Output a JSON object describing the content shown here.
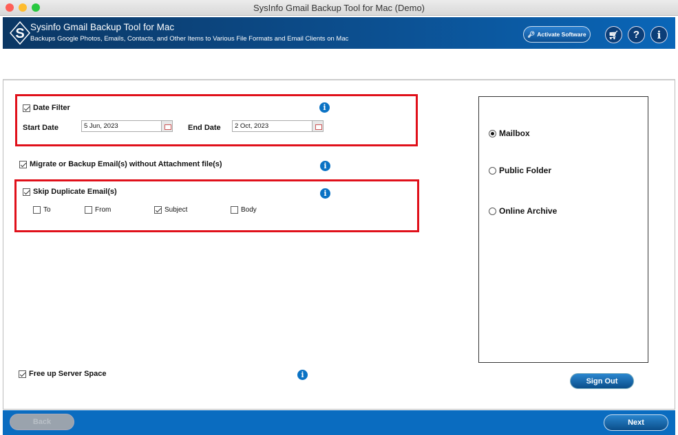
{
  "window": {
    "title": "SysInfo Gmail Backup Tool for Mac (Demo)"
  },
  "header": {
    "title": "Sysinfo Gmail Backup Tool for Mac",
    "subtitle": "Backups Google Photos, Emails, Contacts, and Other Items to Various File Formats and Email Clients on Mac",
    "activate_label": "Activate Software",
    "cart": "cart-icon",
    "help": "?",
    "info": "i"
  },
  "date_filter": {
    "label": "Date Filter",
    "checked": true,
    "start_label": "Start Date",
    "start_value": "5 Jun, 2023",
    "end_label": "End Date",
    "end_value": "2 Oct, 2023"
  },
  "no_attachment": {
    "label": "Migrate or Backup Email(s) without Attachment file(s)",
    "checked": true
  },
  "skip_duplicate": {
    "label": "Skip Duplicate Email(s)",
    "checked": true,
    "options": [
      {
        "label": "To",
        "checked": false
      },
      {
        "label": "From",
        "checked": false
      },
      {
        "label": "Subject",
        "checked": true
      },
      {
        "label": "Body",
        "checked": false
      }
    ]
  },
  "free_space": {
    "label": "Free up Server Space",
    "checked": true
  },
  "mailbox_options": [
    {
      "label": "Mailbox",
      "selected": true
    },
    {
      "label": "Public Folder",
      "selected": false
    },
    {
      "label": "Online Archive",
      "selected": false
    }
  ],
  "buttons": {
    "sign_out": "Sign Out",
    "back": "Back",
    "next": "Next"
  },
  "info_glyph": "i"
}
